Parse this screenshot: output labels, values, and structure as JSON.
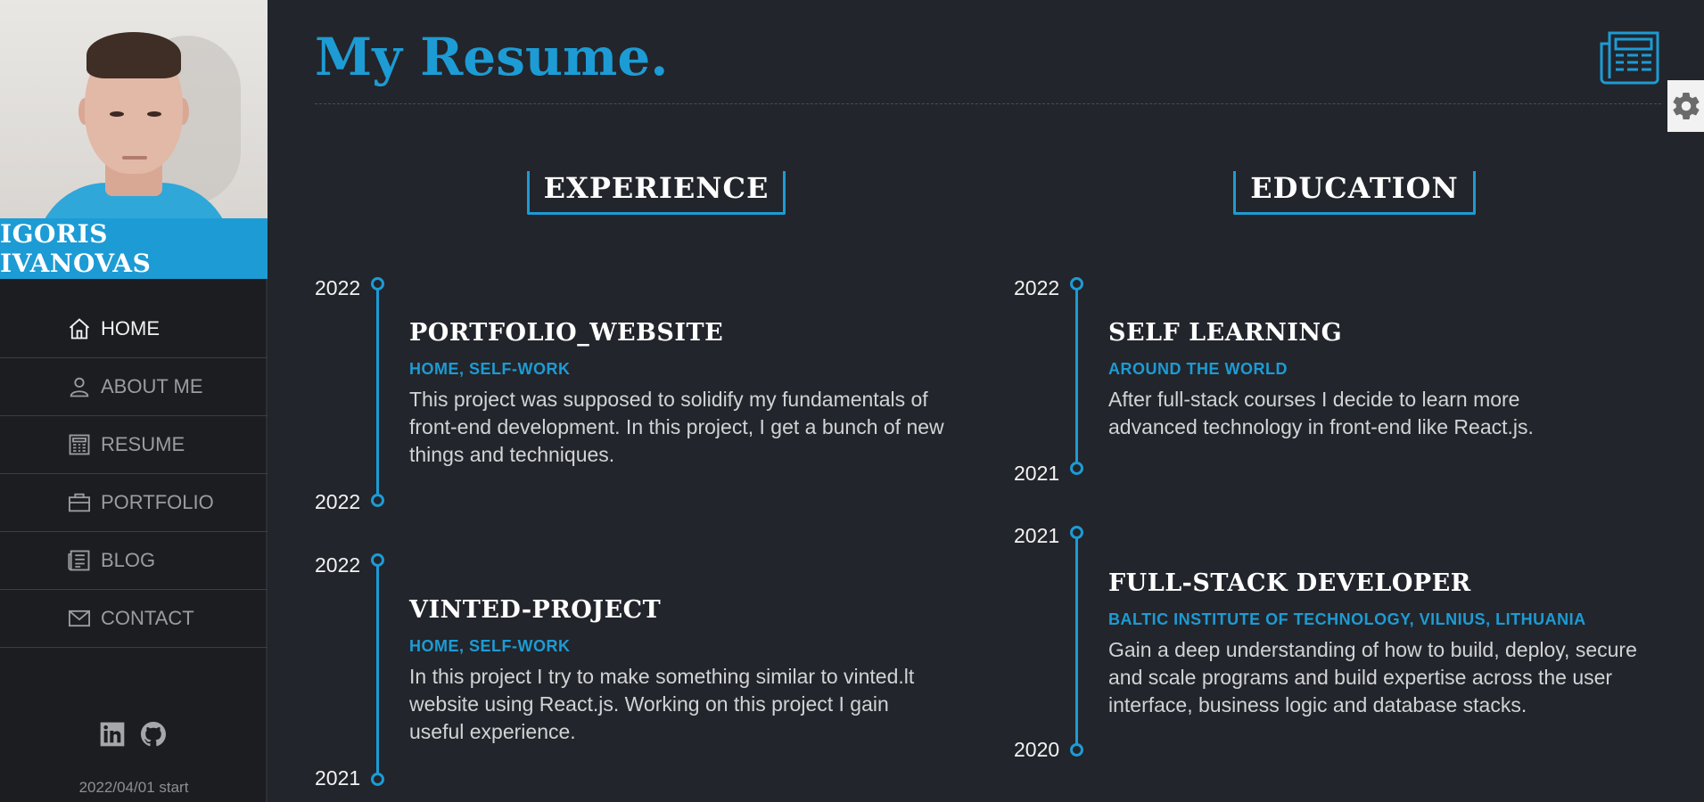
{
  "profile": {
    "name": "IGORIS IVANOVAS",
    "photo_alt": "profile photo"
  },
  "nav": [
    {
      "label": "HOME",
      "icon": "home-icon",
      "active": true
    },
    {
      "label": "ABOUT ME",
      "icon": "user-icon",
      "active": false
    },
    {
      "label": "RESUME",
      "icon": "resume-icon",
      "active": false
    },
    {
      "label": "PORTFOLIO",
      "icon": "briefcase-icon",
      "active": false
    },
    {
      "label": "BLOG",
      "icon": "blog-icon",
      "active": false
    },
    {
      "label": "CONTACT",
      "icon": "mail-icon",
      "active": false
    }
  ],
  "socials": [
    {
      "icon": "linkedin-icon"
    },
    {
      "icon": "github-icon"
    }
  ],
  "start_text": "2022/04/01 start",
  "page": {
    "title": "My Resume.",
    "header_icon": "newspaper-icon",
    "settings_icon": "gear-icon"
  },
  "experience": {
    "heading": "EXPERIENCE",
    "items": [
      {
        "year_start": "2022",
        "year_end": "2022",
        "title": "PORTFOLIO_WEBSITE",
        "subtitle": "HOME, SELF-WORK",
        "description": "This project was supposed to solidify my fundamentals of front-end development. In this project, I get a bunch of new things and techniques."
      },
      {
        "year_start": "2022",
        "year_end": "2021",
        "title": "VINTED-PROJECT",
        "subtitle": "HOME, SELF-WORK",
        "description": "In this project I try to make something similar to vinted.lt website using React.js. Working on this project I gain useful experience."
      }
    ]
  },
  "education": {
    "heading": "EDUCATION",
    "items": [
      {
        "year_start": "2022",
        "year_end": "2021",
        "title": "SELF LEARNING",
        "subtitle": "AROUND THE WORLD",
        "description": "After full-stack courses I decide to learn more advanced technology in front-end like React.js."
      },
      {
        "year_start": "2021",
        "year_end": "2020",
        "title": "FULL-STACK DEVELOPER",
        "subtitle": "BALTIC INSTITUTE OF TECHNOLOGY, VILNIUS, LITHUANIA",
        "description": "Gain a deep understanding of how to build, deploy, secure and scale programs and build expertise across the user interface, business logic and database stacks."
      }
    ]
  },
  "colors": {
    "accent": "#1d9bd4",
    "background": "#22252b",
    "sidebar": "#1c1d21"
  }
}
